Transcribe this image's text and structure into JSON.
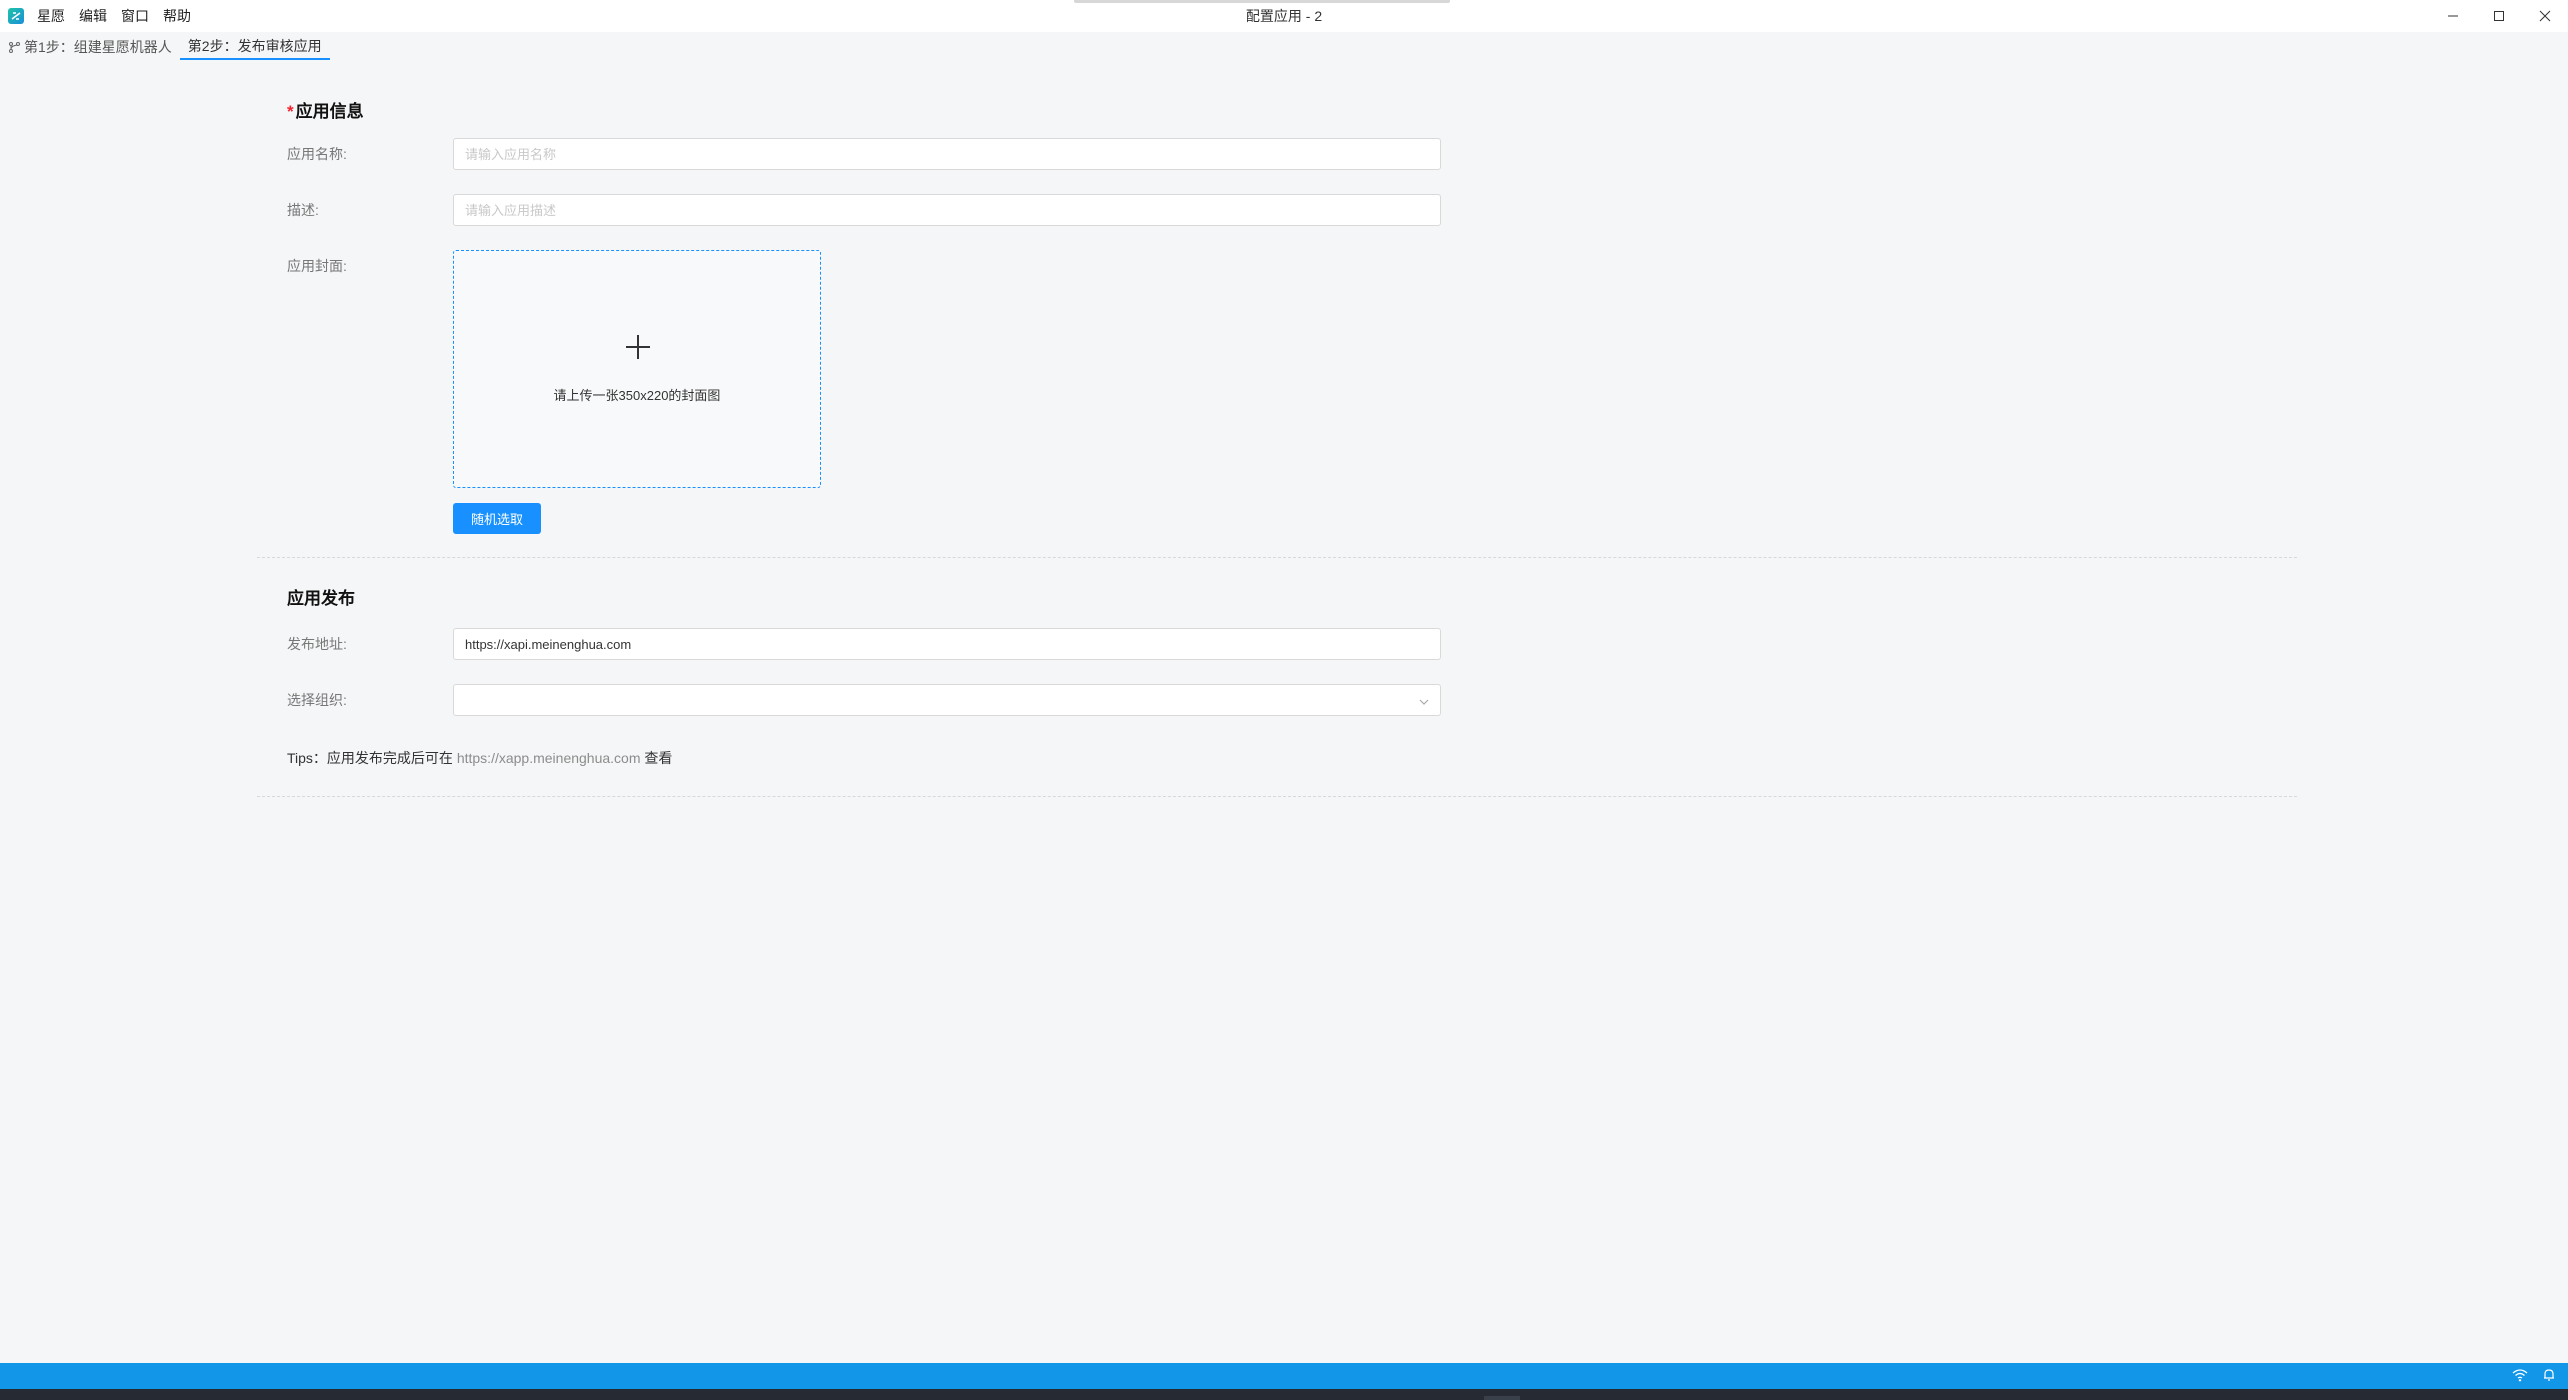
{
  "window": {
    "title": "配置应用 - 2",
    "menu": [
      "星愿",
      "编辑",
      "窗口",
      "帮助"
    ]
  },
  "tabs": [
    {
      "label": "第1步：组建星愿机器人",
      "active": false
    },
    {
      "label": "第2步：发布审核应用",
      "active": true
    }
  ],
  "app_info": {
    "title": "应用信息",
    "required_mark": "*",
    "name_label": "应用名称:",
    "name_placeholder": "请输入应用名称",
    "name_value": "",
    "desc_label": "描述:",
    "desc_placeholder": "请输入应用描述",
    "desc_value": "",
    "cover_label": "应用封面:",
    "upload_hint": "请上传一张350x220的封面图",
    "random_button": "随机选取"
  },
  "publish": {
    "title": "应用发布",
    "address_label": "发布地址:",
    "address_value": "https://xapi.meinenghua.com",
    "org_label": "选择组织:",
    "org_value": "",
    "tips_prefix": "Tips：应用发布完成后可在",
    "tips_link": "https://xapp.meinenghua.com",
    "tips_suffix": "查看"
  },
  "colors": {
    "accent": "#1890ff",
    "statusbar": "#1296e8",
    "required": "#f5222d"
  },
  "icons": {
    "app_logo": "app-logo-icon",
    "tab1": "branch-icon",
    "upload": "plus-icon",
    "select": "chevron-down-icon",
    "status": [
      "wifi-icon",
      "bell-icon"
    ]
  }
}
